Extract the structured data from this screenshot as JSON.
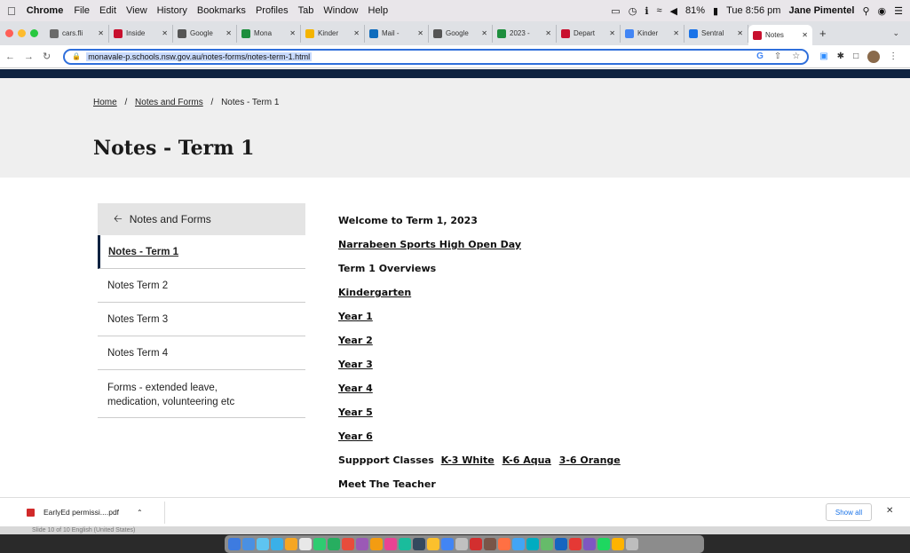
{
  "menubar": {
    "app": "Chrome",
    "items": [
      "File",
      "Edit",
      "View",
      "History",
      "Bookmarks",
      "Profiles",
      "Tab",
      "Window",
      "Help"
    ],
    "battery": "81%",
    "clock": "Tue 8:56 pm",
    "user": "Jane Pimentel"
  },
  "tabs": [
    {
      "label": "cars.fli",
      "color": "#6b6b6b"
    },
    {
      "label": "Inside",
      "color": "#c8102e"
    },
    {
      "label": "Google",
      "color": "#555555"
    },
    {
      "label": "Mona",
      "color": "#1e8e3e"
    },
    {
      "label": "Kinder",
      "color": "#f4b400"
    },
    {
      "label": "Mail -",
      "color": "#0f6cbd"
    },
    {
      "label": "Google",
      "color": "#555555"
    },
    {
      "label": "2023 -",
      "color": "#1e8e3e"
    },
    {
      "label": "Depart",
      "color": "#c8102e"
    },
    {
      "label": "Kinder",
      "color": "#4285f4"
    },
    {
      "label": "Sentral",
      "color": "#1a73e8"
    },
    {
      "label": "Notes",
      "color": "#c8102e",
      "active": true
    }
  ],
  "address": {
    "url": "monavale-p.schools.nsw.gov.au/notes-forms/notes-term-1.html"
  },
  "breadcrumb": {
    "home": "Home",
    "sep": "/",
    "section": "Notes and Forms",
    "current": "Notes - Term 1"
  },
  "page": {
    "title": "Notes - Term 1"
  },
  "sidebar": {
    "back": "Notes and Forms",
    "items": [
      {
        "label": "Notes - Term 1"
      },
      {
        "label": "Notes Term 2"
      },
      {
        "label": "Notes Term 3"
      },
      {
        "label": "Notes Term 4"
      },
      {
        "label": "Forms - extended leave, medication, volunteering etc"
      }
    ]
  },
  "content": {
    "welcome": "Welcome to Term 1, 2023",
    "open_day": "Narrabeen Sports High Open Day",
    "overviews": "Term 1 Overviews",
    "years": [
      "Kindergarten",
      "Year 1",
      "Year 2",
      "Year 3",
      "Year 4",
      "Year 5",
      "Year 6"
    ],
    "support_label": "Suppport Classes",
    "support_links": [
      "K-3 White",
      "K-6 Aqua",
      "3-6 Orange"
    ],
    "meet": "Meet The Teacher"
  },
  "downloads": {
    "file": "EarlyEd permissi....pdf",
    "show_all": "Show all"
  },
  "behind_window": {
    "status": "Slide 10 of 10    English (United States)"
  },
  "dock": {
    "icon_colors": [
      "#3d7be0",
      "#4a90e2",
      "#5ec4f0",
      "#3ab0e8",
      "#f5a623",
      "#e8e8e8",
      "#2ecc71",
      "#27ae60",
      "#e74c3c",
      "#9b59b6",
      "#f39c12",
      "#e84393",
      "#1abc9c",
      "#34495e",
      "#fbc02d",
      "#4285f4",
      "#c0c0c0",
      "#d32f2f",
      "#795548",
      "#ff7043",
      "#42a5f5",
      "#00acc1",
      "#66bb6a",
      "#1565c0",
      "#e53935",
      "#7e57c2",
      "#1ed760",
      "#ffb300",
      "#bdbdbd"
    ]
  }
}
